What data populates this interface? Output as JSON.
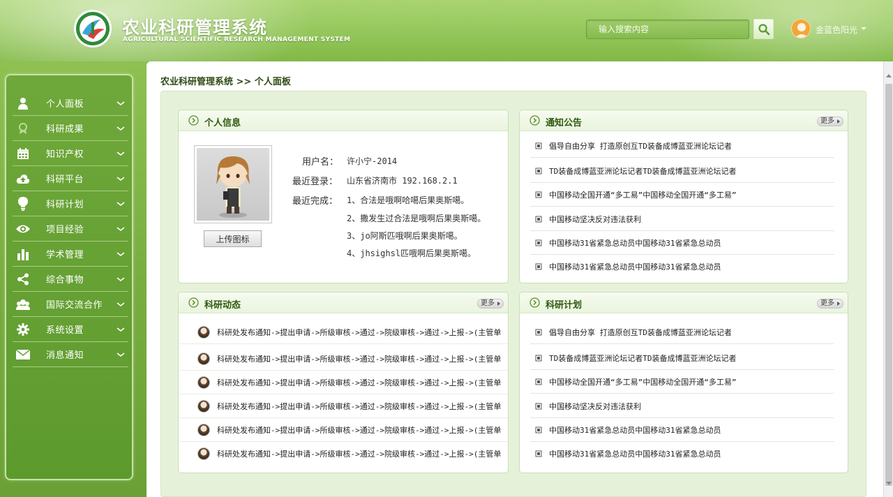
{
  "header": {
    "title": "农业科研管理系统",
    "subtitle": "AGRICULTURAL SCIENTIFIC RESEARCH MANAGEMENT SYSTEM",
    "search_placeholder": "输入搜索内容",
    "user_name": "金蓝色阳光"
  },
  "sidebar": {
    "items": [
      {
        "label": "个人面板",
        "icon": "user-icon"
      },
      {
        "label": "科研成果",
        "icon": "award-icon"
      },
      {
        "label": "知识产权",
        "icon": "calendar-icon"
      },
      {
        "label": "科研平台",
        "icon": "cloud-upload-icon"
      },
      {
        "label": "科研计划",
        "icon": "lightbulb-icon"
      },
      {
        "label": "项目经验",
        "icon": "eye-icon"
      },
      {
        "label": "学术管理",
        "icon": "bar-chart-icon"
      },
      {
        "label": "综合事物",
        "icon": "share-icon"
      },
      {
        "label": "国际交流合作",
        "icon": "group-icon"
      },
      {
        "label": "系统设置",
        "icon": "gear-icon"
      },
      {
        "label": "消息通知",
        "icon": "mail-icon"
      }
    ]
  },
  "breadcrumb": "农业科研管理系统 >> 个人面板",
  "personal_info": {
    "title": "个人信息",
    "upload_label": "上传图标",
    "username_label": "用户名：",
    "username_value": "许小宁-2014",
    "last_login_label": "最近登录：",
    "last_login_value": "山东省济南市  192.168.2.1",
    "recent_label": "最近完成：",
    "recent_items": [
      "1、合法是哦啊哈噶后果奥斯噶。",
      "2、撒发生过合法是哦啊后果奥斯噶。",
      "3、jo阿斯匹哦啊后果奥斯噶。",
      "4、jhsighsl匹哦啊后果奥斯噶。"
    ]
  },
  "notice": {
    "title": "通知公告",
    "more": "更多",
    "items": [
      "倡导自由分享 打造原创互TD装备成博蓝亚洲论坛记者",
      "TD装备成博蓝亚洲论坛记者TD装备成博蓝亚洲论坛记者",
      "中国移动全国开通“多工易”中国移动全国开通“多工易”",
      "中国移动坚决反对违法获利",
      "中国移动31省紧急总动员中国移动31省紧急总动员",
      "中国移动31省紧急总动员中国移动31省紧急总动员"
    ]
  },
  "dynamics": {
    "title": "科研动态",
    "more": "更多",
    "items": [
      "科研处发布通知->提出申请->所级审核->通过->院级审核->通过->上报->(主管单",
      "科研处发布通知->提出申请->所级审核->通过->院级审核->通过->上报->(主管单",
      "科研处发布通知->提出申请->所级审核->通过->院级审核->通过->上报->(主管单",
      "科研处发布通知->提出申请->所级审核->通过->院级审核->通过->上报->(主管单",
      "科研处发布通知->提出申请->所级审核->通过->院级审核->通过->上报->(主管单",
      "科研处发布通知->提出申请->所级审核->通过->院级审核->通过->上报->(主管单"
    ]
  },
  "plan": {
    "title": "科研计划",
    "more": "更多",
    "items": [
      "倡导自由分享 打造原创互TD装备成博蓝亚洲论坛记者",
      "TD装备成博蓝亚洲论坛记者TD装备成博蓝亚洲论坛记者",
      "中国移动全国开通“多工易”中国移动全国开通“多工易”",
      "中国移动坚决反对违法获利",
      "中国移动31省紧急总动员中国移动31省紧急总动员",
      "中国移动31省紧急总动员中国移动31省紧急总动员"
    ]
  },
  "colors": {
    "accent": "#5d9a2e",
    "header_bg": "#93c65a",
    "card_title": "#2f5a0e"
  }
}
